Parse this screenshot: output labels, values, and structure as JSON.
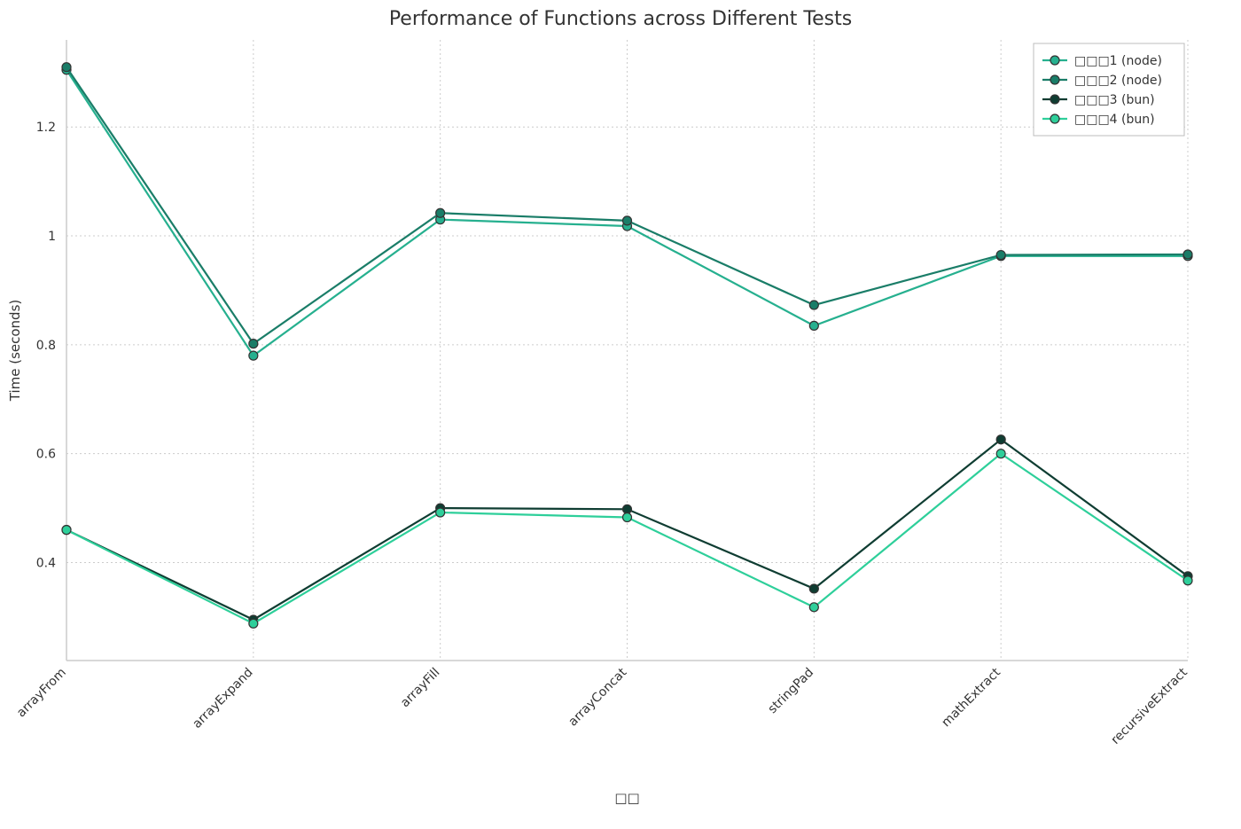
{
  "chart_data": {
    "type": "line",
    "title": "Performance of Functions across Different Tests",
    "xlabel": "□□",
    "ylabel": "Time (seconds)",
    "categories": [
      "arrayFrom",
      "arrayExpand",
      "arrayFill",
      "arrayConcat",
      "stringPad",
      "mathExtract",
      "recursiveExtract"
    ],
    "series": [
      {
        "name": "□□□1 (node)",
        "color": "#26b08f",
        "values": [
          1.305,
          0.78,
          1.03,
          1.018,
          0.835,
          0.963,
          0.963
        ]
      },
      {
        "name": "□□□2 (node)",
        "color": "#1a7d68",
        "values": [
          1.31,
          0.802,
          1.042,
          1.028,
          0.873,
          0.965,
          0.966
        ]
      },
      {
        "name": "□□□3 (bun)",
        "color": "#0f3d32",
        "values": [
          0.46,
          0.295,
          0.5,
          0.498,
          0.352,
          0.626,
          0.375
        ]
      },
      {
        "name": "□□□4 (bun)",
        "color": "#2ecf9a",
        "values": [
          0.46,
          0.288,
          0.492,
          0.483,
          0.318,
          0.6,
          0.367
        ]
      }
    ],
    "ylim": [
      0.22,
      1.36
    ],
    "yticks": [
      0.4,
      0.6,
      0.8,
      1.0,
      1.2
    ],
    "grid": true,
    "legend_position": "upper-right"
  }
}
